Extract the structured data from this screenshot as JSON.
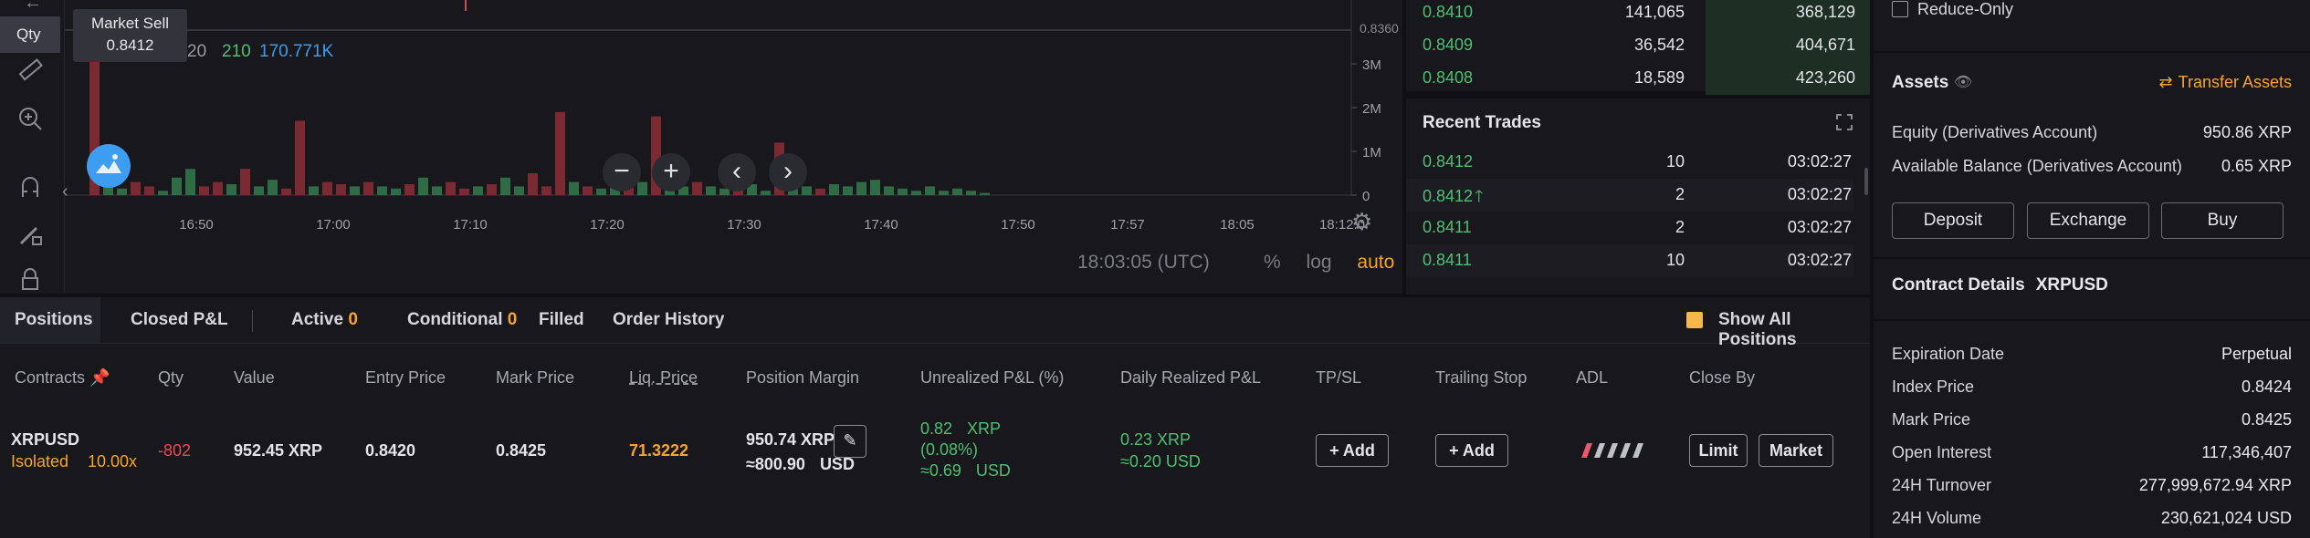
{
  "chart": {
    "qty_tag": "Qty",
    "tooltip_title": "Market Sell",
    "tooltip_value": "0.8412",
    "volume_line_partial": "20",
    "volume_green": "210",
    "volume_blue": "170.771K",
    "price_label": "0.8360",
    "y_axis_labels": [
      "3M",
      "2M",
      "1M",
      "0"
    ],
    "x_axis_labels": [
      "16:50",
      "17:00",
      "17:10",
      "17:20",
      "17:30",
      "17:40",
      "17:50",
      "17:57",
      "18:05",
      "18:12:0"
    ],
    "timezone_text": "18:03:05 (UTC)",
    "scale_percent": "%",
    "scale_log": "log",
    "scale_auto": "auto",
    "volume_bars": [
      {
        "v": 3.1,
        "c": "red"
      },
      {
        "v": 0.25,
        "c": "green"
      },
      {
        "v": 0.15,
        "c": "green"
      },
      {
        "v": 0.3,
        "c": "red"
      },
      {
        "v": 0.2,
        "c": "red"
      },
      {
        "v": 0.1,
        "c": "green"
      },
      {
        "v": 0.4,
        "c": "green"
      },
      {
        "v": 0.6,
        "c": "green"
      },
      {
        "v": 0.2,
        "c": "red"
      },
      {
        "v": 0.3,
        "c": "red"
      },
      {
        "v": 0.25,
        "c": "green"
      },
      {
        "v": 0.6,
        "c": "red"
      },
      {
        "v": 0.2,
        "c": "green"
      },
      {
        "v": 0.35,
        "c": "green"
      },
      {
        "v": 0.15,
        "c": "red"
      },
      {
        "v": 1.7,
        "c": "red"
      },
      {
        "v": 0.2,
        "c": "green"
      },
      {
        "v": 0.3,
        "c": "red"
      },
      {
        "v": 0.25,
        "c": "red"
      },
      {
        "v": 0.2,
        "c": "green"
      },
      {
        "v": 0.3,
        "c": "red"
      },
      {
        "v": 0.2,
        "c": "green"
      },
      {
        "v": 0.15,
        "c": "green"
      },
      {
        "v": 0.25,
        "c": "red"
      },
      {
        "v": 0.4,
        "c": "green"
      },
      {
        "v": 0.2,
        "c": "green"
      },
      {
        "v": 0.3,
        "c": "red"
      },
      {
        "v": 0.15,
        "c": "red"
      },
      {
        "v": 0.2,
        "c": "green"
      },
      {
        "v": 0.25,
        "c": "red"
      },
      {
        "v": 0.4,
        "c": "green"
      },
      {
        "v": 0.2,
        "c": "green"
      },
      {
        "v": 0.5,
        "c": "red"
      },
      {
        "v": 0.2,
        "c": "red"
      },
      {
        "v": 1.9,
        "c": "red"
      },
      {
        "v": 0.3,
        "c": "green"
      },
      {
        "v": 0.2,
        "c": "red"
      },
      {
        "v": 0.15,
        "c": "green"
      },
      {
        "v": 0.25,
        "c": "green"
      },
      {
        "v": 0.2,
        "c": "red"
      },
      {
        "v": 0.3,
        "c": "green"
      },
      {
        "v": 1.8,
        "c": "red"
      },
      {
        "v": 0.4,
        "c": "green"
      },
      {
        "v": 0.2,
        "c": "green"
      },
      {
        "v": 0.3,
        "c": "red"
      },
      {
        "v": 0.2,
        "c": "green"
      },
      {
        "v": 0.15,
        "c": "green"
      },
      {
        "v": 0.2,
        "c": "red"
      },
      {
        "v": 0.25,
        "c": "green"
      },
      {
        "v": 0.1,
        "c": "green"
      },
      {
        "v": 1.2,
        "c": "red"
      },
      {
        "v": 0.3,
        "c": "green"
      },
      {
        "v": 0.2,
        "c": "green"
      },
      {
        "v": 0.15,
        "c": "red"
      },
      {
        "v": 0.25,
        "c": "green"
      },
      {
        "v": 0.2,
        "c": "green"
      },
      {
        "v": 0.3,
        "c": "green"
      },
      {
        "v": 0.35,
        "c": "green"
      },
      {
        "v": 0.2,
        "c": "green"
      },
      {
        "v": 0.15,
        "c": "green"
      },
      {
        "v": 0.1,
        "c": "green"
      },
      {
        "v": 0.2,
        "c": "green"
      },
      {
        "v": 0.1,
        "c": "green"
      },
      {
        "v": 0.15,
        "c": "green"
      },
      {
        "v": 0.1,
        "c": "green"
      },
      {
        "v": 0.05,
        "c": "green"
      }
    ]
  },
  "orderbook": {
    "rows": [
      {
        "price": "0.8410",
        "qty": "141,065",
        "total": "368,129"
      },
      {
        "price": "0.8409",
        "qty": "36,542",
        "total": "404,671"
      },
      {
        "price": "0.8408",
        "qty": "18,589",
        "total": "423,260"
      }
    ]
  },
  "recent_trades": {
    "title": "Recent Trades",
    "rows": [
      {
        "price": "0.8412",
        "qty": "10",
        "time": "03:02:27",
        "up": false
      },
      {
        "price": "0.8412",
        "qty": "2",
        "time": "03:02:27",
        "up": true
      },
      {
        "price": "0.8411",
        "qty": "2",
        "time": "03:02:27",
        "up": false
      },
      {
        "price": "0.8411",
        "qty": "10",
        "time": "03:02:27",
        "up": false
      }
    ]
  },
  "right_panel": {
    "reduce_only": "Reduce-Only",
    "assets_title": "Assets",
    "transfer_assets": "Transfer Assets",
    "equity_label": "Equity (Derivatives Account)",
    "equity_value": "950.86 XRP",
    "available_label": "Available Balance (Derivatives Account)",
    "available_value": "0.65 XRP",
    "deposit": "Deposit",
    "exchange": "Exchange",
    "buy": "Buy",
    "contract_details_title": "Contract Details",
    "contract_symbol": "XRPUSD",
    "details": [
      {
        "label": "Expiration Date",
        "value": "Perpetual"
      },
      {
        "label": "Index Price",
        "value": "0.8424"
      },
      {
        "label": "Mark Price",
        "value": "0.8425"
      },
      {
        "label": "Open Interest",
        "value": "117,346,407"
      },
      {
        "label": "24H Turnover",
        "value": "277,999,672.94 XRP"
      },
      {
        "label": "24H Volume",
        "value": "230,621,024 USD"
      }
    ]
  },
  "positions": {
    "tabs": {
      "positions": "Positions",
      "closed_pnl": "Closed P&L",
      "active": "Active",
      "active_count": "0",
      "conditional": "Conditional",
      "conditional_count": "0",
      "filled": "Filled",
      "order_history": "Order History",
      "show_all": "Show All Positions"
    },
    "headers": {
      "contracts": "Contracts",
      "qty": "Qty",
      "value": "Value",
      "entry_price": "Entry Price",
      "mark_price": "Mark Price",
      "liq_price": "Liq. Price",
      "position_margin": "Position Margin",
      "unrealized_pnl": "Unrealized P&L (%)",
      "daily_realized_pnl": "Daily Realized P&L",
      "tpsl": "TP/SL",
      "trailing_stop": "Trailing Stop",
      "adl": "ADL",
      "close_by": "Close By"
    },
    "row": {
      "symbol": "XRPUSD",
      "mode": "Isolated",
      "leverage": "10.00x",
      "qty": "-802",
      "value": "952.45 XRP",
      "entry_price": "0.8420",
      "mark_price": "0.8425",
      "liq_price": "71.3222",
      "margin_xrp": "950.74 XRP",
      "margin_usd": "≈800.90",
      "margin_usd_unit": "USD",
      "upnl_xrp": "0.82",
      "upnl_xrp_unit": "XRP",
      "upnl_pct": "(0.08%)",
      "upnl_usd": "≈0.69",
      "upnl_usd_unit": "USD",
      "drpnl_xrp": "0.23 XRP",
      "drpnl_usd": "≈0.20 USD",
      "tpsl_add": "Add",
      "trailing_add": "Add",
      "close_limit": "Limit",
      "close_market": "Market"
    }
  }
}
